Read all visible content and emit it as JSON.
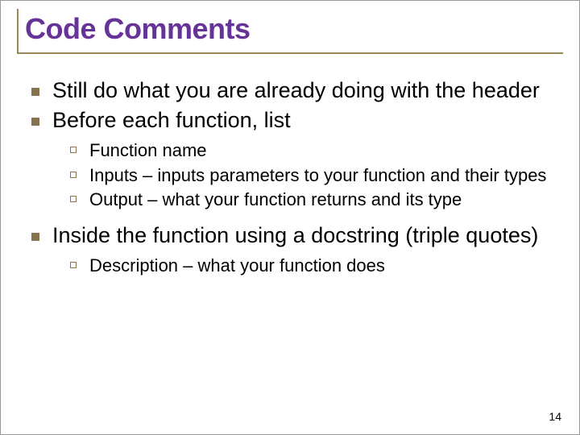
{
  "title": "Code Comments",
  "bullets": [
    {
      "text": "Still do what you are already doing with the header"
    },
    {
      "text": "Before each function, list",
      "sub": [
        "Function name",
        "Inputs – inputs parameters to your function and their types",
        "Output – what your function returns and its type"
      ]
    },
    {
      "text": "Inside the function using a docstring (triple quotes)",
      "sub": [
        "Description – what your function does"
      ]
    }
  ],
  "page_number": "14"
}
